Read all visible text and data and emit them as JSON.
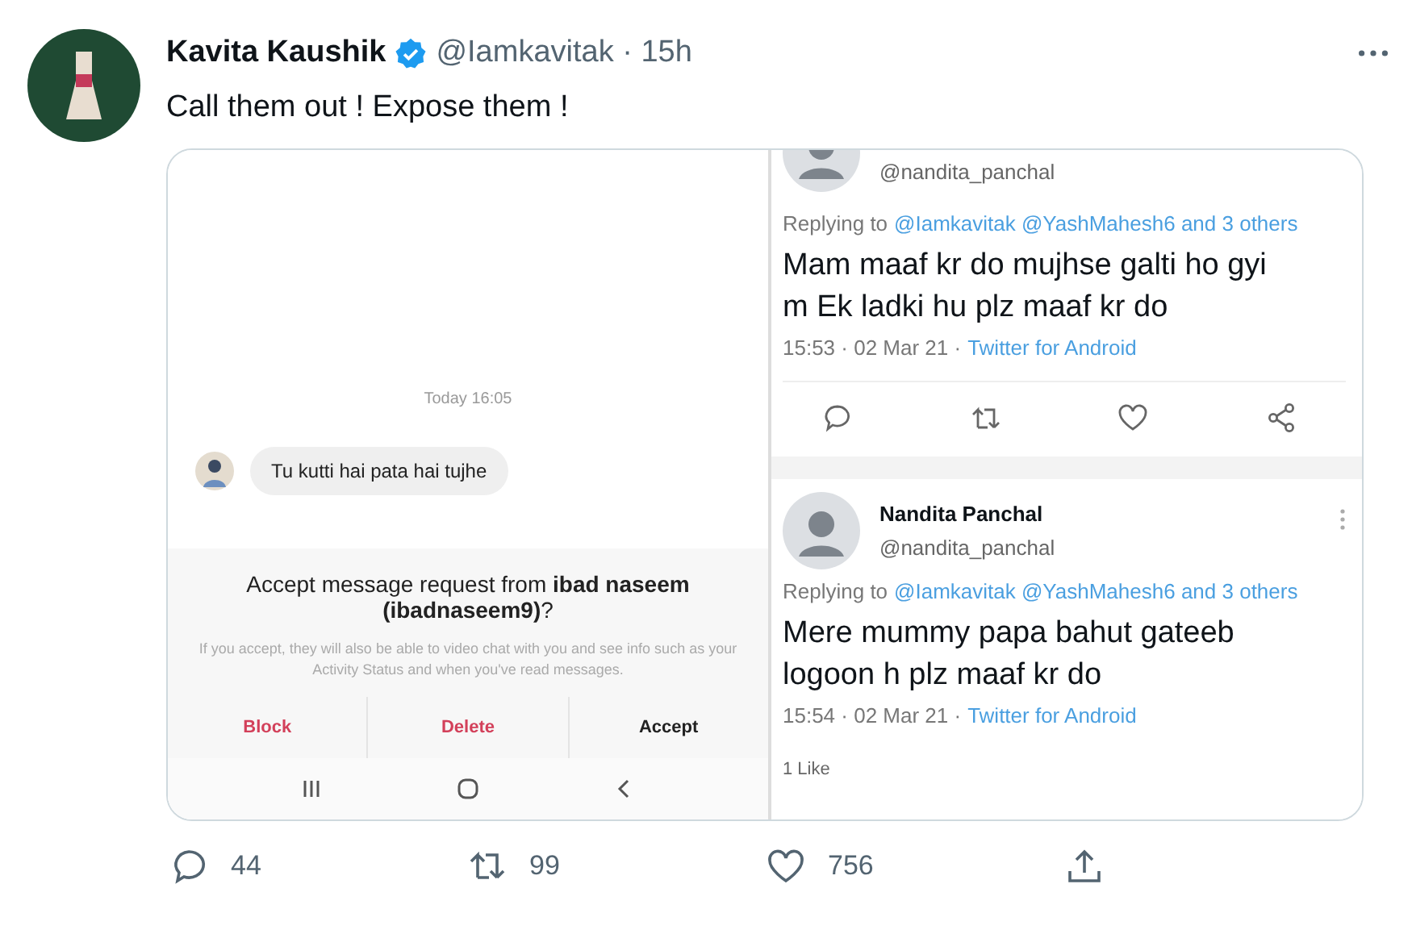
{
  "tweet": {
    "author": {
      "name": "Kavita Kaushik",
      "verified": true,
      "meta": "@Iamkavitak · 15h"
    },
    "text": "Call them out ! Expose them !"
  },
  "media": {
    "chat": {
      "date": "Today 16:05",
      "message": "Tu kutti hai pata hai tujhe",
      "request_title": "Accept message request from **ibad naseem (ibadnaseem9)**?",
      "request_body": "If you accept, they will also be able to video chat with you and see info such as your Activity Status and when you've read messages.",
      "buttons": [
        {
          "label": "Block",
          "kind": "destructive"
        },
        {
          "label": "Delete",
          "kind": "destructive"
        },
        {
          "label": "Accept",
          "kind": "default"
        }
      ],
      "nav": [
        {
          "kind": "recents"
        },
        {
          "kind": "home"
        },
        {
          "kind": "back"
        }
      ]
    },
    "replies": [
      {
        "cut_top": true,
        "handle": "@nandita_panchal",
        "replying_label": "Replying to",
        "replying_to": "@Iamkavitak @YashMahesh6 and 3 others",
        "text": "Mam maaf kr do mujhse galti ho gyi m Ek ladki hu plz maaf kr do",
        "time": "15:53 · 02 Mar 21 ·",
        "source": "Twitter for Android",
        "actions": [
          {
            "kind": "reply"
          },
          {
            "kind": "retweet"
          },
          {
            "kind": "like"
          },
          {
            "kind": "share"
          }
        ]
      },
      {
        "cut_top": false,
        "name": "Nandita Panchal",
        "handle": "@nandita_panchal",
        "replying_label": "Replying to",
        "replying_to": "@Iamkavitak @YashMahesh6 and 3 others",
        "text": "Mere mummy papa bahut gateeb logoon h plz maaf kr do",
        "time": "15:54 · 02 Mar 21 ·",
        "source": "Twitter for Android",
        "likes": "1 Like"
      }
    ]
  },
  "actions": [
    {
      "kind": "reply",
      "count": "44"
    },
    {
      "kind": "retweet",
      "count": "99"
    },
    {
      "kind": "like",
      "count": "756"
    },
    {
      "kind": "share"
    }
  ]
}
